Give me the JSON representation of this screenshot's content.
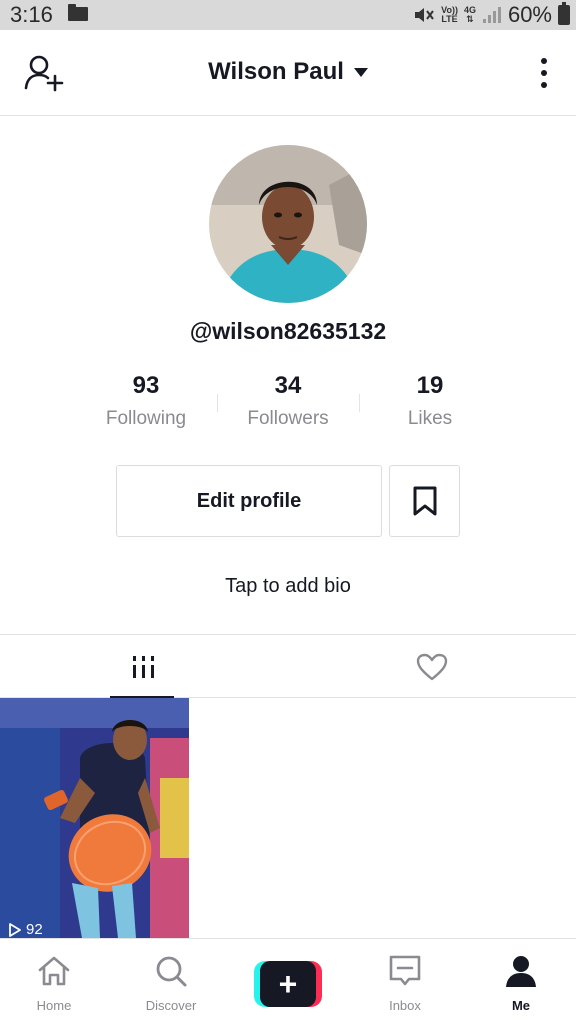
{
  "status_bar": {
    "time": "3:16",
    "volte": "Vo))",
    "lte": "LTE",
    "network": "4G",
    "battery": "60%"
  },
  "header": {
    "title": "Wilson Paul"
  },
  "profile": {
    "handle": "@wilson82635132",
    "stats": [
      {
        "value": "93",
        "label": "Following"
      },
      {
        "value": "34",
        "label": "Followers"
      },
      {
        "value": "19",
        "label": "Likes"
      }
    ],
    "edit_profile_label": "Edit profile",
    "bio_prompt": "Tap to add bio"
  },
  "tabs": [
    {
      "icon": "grid-icon",
      "active": true
    },
    {
      "icon": "heart-icon",
      "active": false
    }
  ],
  "videos": [
    {
      "views": "92"
    }
  ],
  "bottom_nav": [
    {
      "label": "Home",
      "icon": "home-icon"
    },
    {
      "label": "Discover",
      "icon": "search-icon"
    },
    {
      "label": "",
      "icon": "plus-icon"
    },
    {
      "label": "Inbox",
      "icon": "inbox-icon"
    },
    {
      "label": "Me",
      "icon": "person-icon",
      "active": true
    }
  ],
  "colors": {
    "accent_red": "#fe2c55",
    "accent_cyan": "#25f4ee",
    "text_primary": "#161823",
    "text_secondary": "#8a8b91"
  }
}
